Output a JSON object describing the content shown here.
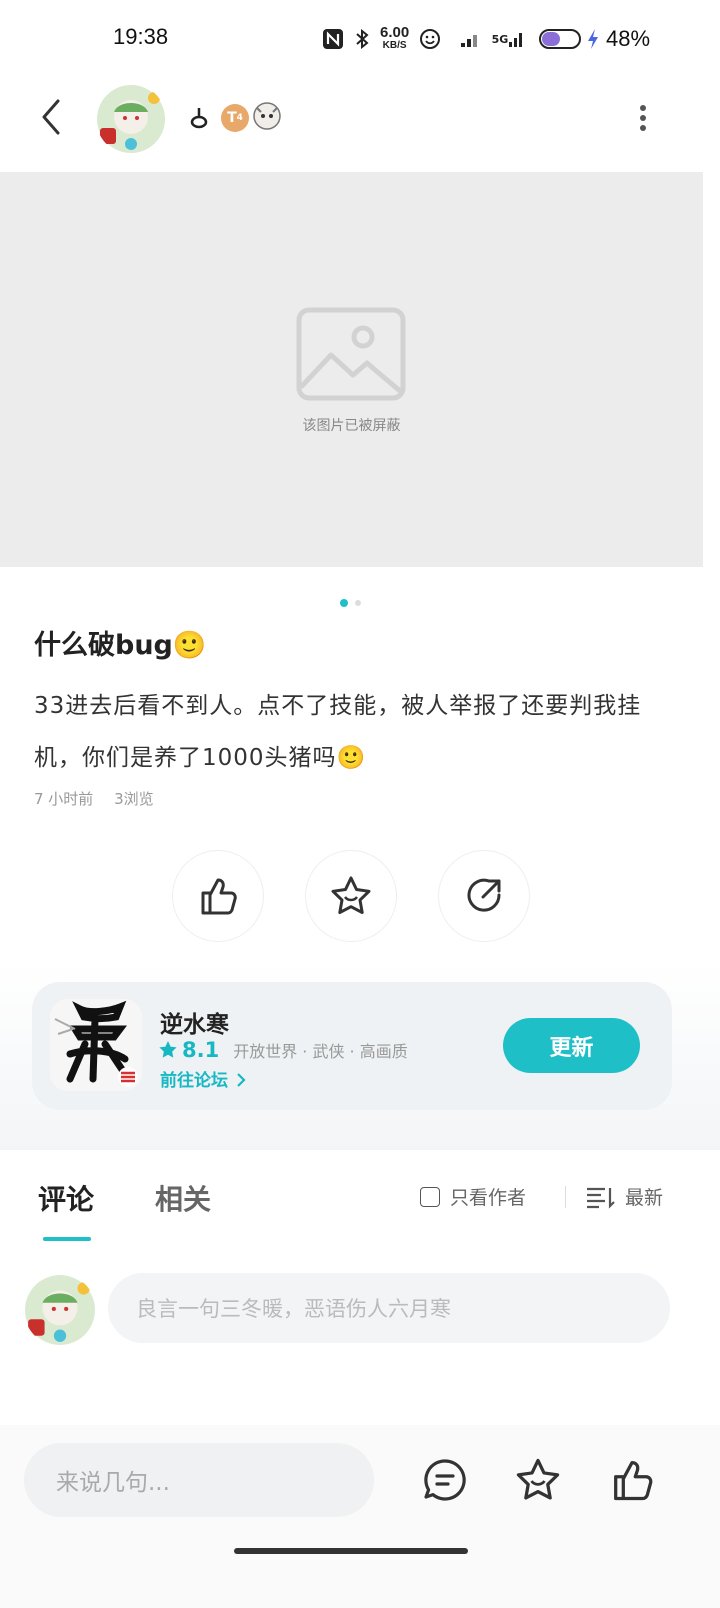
{
  "status": {
    "time": "19:38",
    "net_speed_top": "6.00",
    "net_speed_bottom": "KB/S",
    "network_label": "5G",
    "battery": "48%"
  },
  "header": {
    "level_badge": "T",
    "level_badge_sub": "4"
  },
  "image": {
    "blocked_text": "该图片已被屏蔽",
    "total": 2,
    "current": 1
  },
  "post": {
    "title": "什么破bug🙂",
    "body": "33进去后看不到人。点不了技能，被人举报了还要判我挂机，你们是养了1000头猪吗🙂",
    "time_ago": "7 小时前",
    "views": "3浏览"
  },
  "game": {
    "name": "逆水寒",
    "rating": "8.1",
    "tags": "开放世界 · 武侠 · 高画质",
    "forum_link": "前往论坛",
    "update_label": "更新"
  },
  "comments": {
    "tab_comments": "评论",
    "tab_related": "相关",
    "author_only": "只看作者",
    "sort_label": "最新",
    "input_placeholder": "良言一句三冬暖，恶语伤人六月寒"
  },
  "bottom": {
    "say_placeholder": "来说几句..."
  },
  "colors": {
    "accent": "#1fbfc8"
  }
}
